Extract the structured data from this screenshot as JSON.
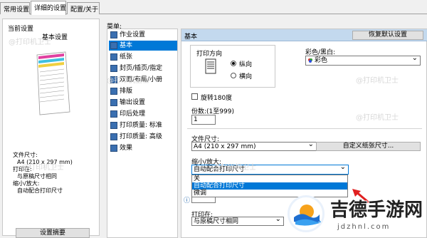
{
  "tabs": [
    {
      "label": "常用设置"
    },
    {
      "label": "详细的设置"
    },
    {
      "label": "配置/关于"
    }
  ],
  "left_panel": {
    "title": "当前设置",
    "subtitle": "基本设置",
    "info": {
      "paper_size_label": "文件尺寸:",
      "paper_size_value": "A4 (210 x 297 mm)",
      "print_on_label": "打印在:",
      "print_on_value": "与原稿尺寸相同",
      "scale_label": "缩小/放大:",
      "scale_value": "自动配合打印尺寸"
    },
    "summary_button": "设置摘要"
  },
  "menu": {
    "label": "菜单:",
    "items": [
      {
        "label": "作业设置",
        "icon": "job-settings-icon"
      },
      {
        "label": "基本",
        "icon": "basic-icon",
        "selected": true
      },
      {
        "label": "纸张",
        "icon": "paper-icon"
      },
      {
        "label": "封页/插页/指定",
        "icon": "cover-icon"
      },
      {
        "label": "双面/布局/小册",
        "icon": "duplex-icon"
      },
      {
        "label": "排版",
        "icon": "layout-icon"
      },
      {
        "label": "输出设置",
        "icon": "output-icon"
      },
      {
        "label": "印后处理",
        "icon": "finishing-icon"
      },
      {
        "label": "打印质量: 标准",
        "icon": "quality-standard-icon"
      },
      {
        "label": "打印质量: 高级",
        "icon": "quality-advanced-icon"
      },
      {
        "label": "效果",
        "icon": "effects-icon"
      }
    ]
  },
  "main": {
    "header_title": "基本",
    "restore_button": "恢复默认设置",
    "orientation": {
      "label": "打印方向",
      "portrait": "纵向",
      "landscape": "横向",
      "selected": "portrait"
    },
    "color": {
      "label": "彩色/黑白:",
      "value": "彩色"
    },
    "rotate_label": "旋转180度",
    "copies": {
      "label": "份数:(1至999)",
      "value": "1"
    },
    "paper_size": {
      "label": "文件尺寸:",
      "value": "A4 (210 x 297 mm)",
      "custom_button": "自定义纸张尺寸..."
    },
    "scale": {
      "label": "缩小/放大:",
      "value": "自动配合打印尺寸",
      "options": [
        "关",
        "自动配合打印尺寸",
        "微调"
      ],
      "selected_index": 1
    },
    "print_on": {
      "label": "打印在:",
      "value": "与原稿尺寸相同"
    }
  },
  "watermark_text": "@打印机卫士",
  "logo": {
    "name": "吉德手游网",
    "url": "jdzhnl.com"
  }
}
